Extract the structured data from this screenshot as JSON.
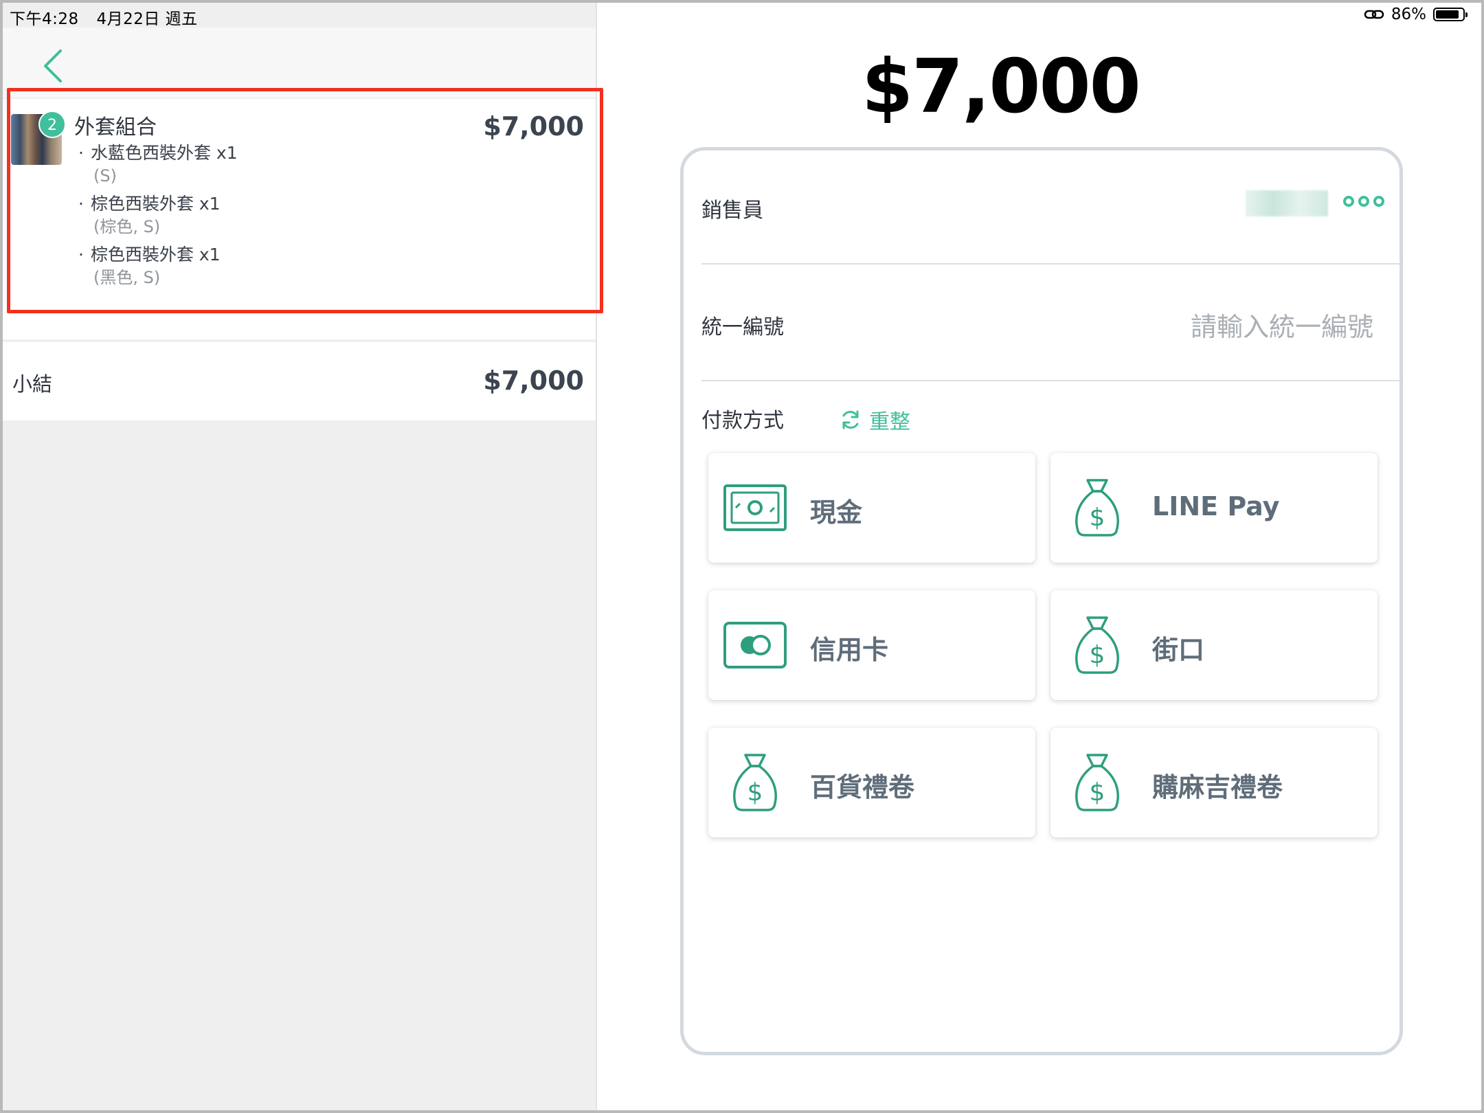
{
  "status_bar": {
    "time": "下午4:28",
    "date": "4月22日 週五",
    "battery_percent": "86%",
    "battery_level": 0.86
  },
  "order": {
    "item": {
      "name": "外套組合",
      "price": "$7,000",
      "badge_count": "2",
      "variants": [
        {
          "name": "水藍色西裝外套 x1",
          "spec": "(S)"
        },
        {
          "name": "棕色西裝外套 x1",
          "spec": "(棕色, S)"
        },
        {
          "name": "棕色西裝外套 x1",
          "spec": "(黑色, S)"
        }
      ]
    },
    "subtotal_label": "小結",
    "subtotal_value": "$7,000"
  },
  "checkout": {
    "total": "$7,000",
    "seller_label": "銷售員",
    "tax_id_label": "統一編號",
    "tax_id_placeholder": "請輸入統一編號",
    "tax_id_value": "",
    "payment_label": "付款方式",
    "reset_label": "重整",
    "payment_methods": [
      {
        "label": "現金",
        "icon": "cash-icon"
      },
      {
        "label": "LINE Pay",
        "icon": "money-bag-icon"
      },
      {
        "label": "信用卡",
        "icon": "credit-card-icon"
      },
      {
        "label": "街口",
        "icon": "money-bag-icon"
      },
      {
        "label": "百貨禮卷",
        "icon": "money-bag-icon"
      },
      {
        "label": "購麻吉禮卷",
        "icon": "money-bag-icon"
      }
    ]
  },
  "colors": {
    "accent": "#3fbf9b",
    "highlight": "#f2301f",
    "text": "#2e333d",
    "muted": "#a9afb5"
  }
}
